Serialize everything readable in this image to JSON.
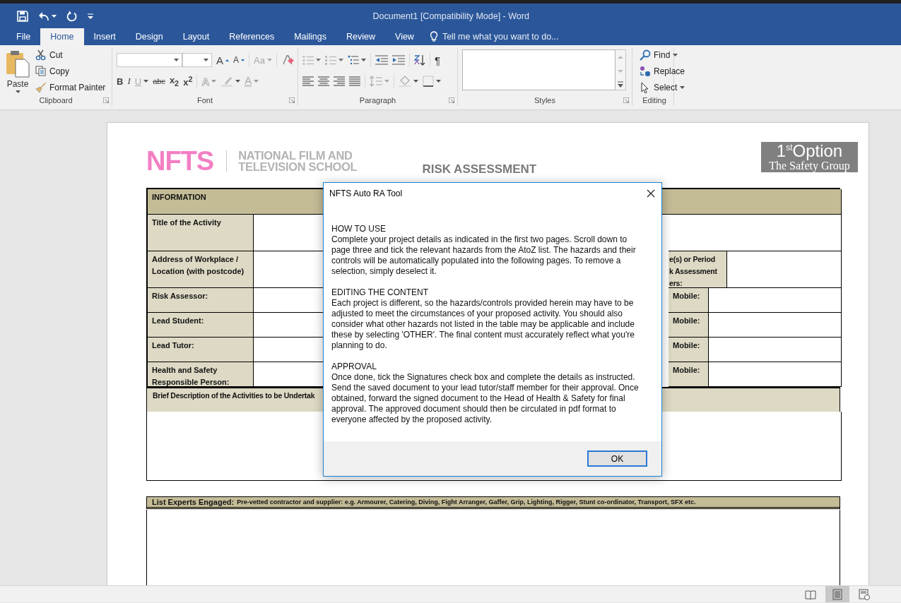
{
  "window": {
    "title": "Document1 [Compatibility Mode] - Word"
  },
  "tabs": [
    {
      "label": "File",
      "selected": false
    },
    {
      "label": "Home",
      "selected": true
    },
    {
      "label": "Insert",
      "selected": false
    },
    {
      "label": "Design",
      "selected": false
    },
    {
      "label": "Layout",
      "selected": false
    },
    {
      "label": "References",
      "selected": false
    },
    {
      "label": "Mailings",
      "selected": false
    },
    {
      "label": "Review",
      "selected": false
    },
    {
      "label": "View",
      "selected": false
    }
  ],
  "tell_me": {
    "placeholder": "Tell me what you want to do..."
  },
  "clipboard": {
    "label": "Clipboard",
    "paste": "Paste",
    "actions": [
      {
        "label": "Cut",
        "kind": "cut"
      },
      {
        "label": "Copy",
        "kind": "copy"
      },
      {
        "label": "Format Painter",
        "kind": "painter"
      }
    ]
  },
  "font": {
    "label": "Font",
    "size_buttons": [
      {
        "label": "A",
        "kind": "grow"
      },
      {
        "label": "A",
        "kind": "shrink"
      }
    ],
    "change_case": {
      "label": "Aa",
      "disabled": true
    },
    "styles": [
      {
        "label": "B",
        "kind": "bold",
        "disabled": false
      },
      {
        "label": "I",
        "kind": "italic",
        "disabled": false
      },
      {
        "label": "U",
        "kind": "underline",
        "disabled": true
      },
      {
        "label": "abc",
        "kind": "strike",
        "disabled": false
      },
      {
        "label": "x$_{2}$",
        "kind": "sub",
        "disabled": false
      },
      {
        "label": "x$^{2}$",
        "kind": "sup",
        "disabled": false
      }
    ],
    "effects": [
      {
        "label": "A",
        "kind": "effects",
        "disabled": true
      },
      {
        "label": "A",
        "kind": "color",
        "disabled": true
      }
    ]
  },
  "paragraph": {
    "label": "Paragraph",
    "show_marks": "¶"
  },
  "styles": {
    "label": "Styles"
  },
  "editing": {
    "label": "Editing",
    "actions": [
      {
        "label": "Find",
        "kind": "find"
      },
      {
        "label": "Replace",
        "kind": "replace"
      },
      {
        "label": "Select",
        "kind": "select"
      }
    ]
  },
  "document": {
    "logo": {
      "mark": "NFTS",
      "name_lines": [
        "NATIONAL FILM AND",
        "TELEVISION SCHOOL"
      ]
    },
    "heading": "RISK ASSESSMENT",
    "partner": {
      "name": "1$^{st}$Option",
      "tagline": "The Safety Group"
    },
    "table": {
      "header": "INFORMATION",
      "rows": [
        {
          "label": "Title of the Activity",
          "kind": "title"
        },
        {
          "label": "Address of Workplace / Location (with postcode)",
          "kind": "address",
          "side_label": "e(s) or Period\nk Assessment\ners:"
        },
        {
          "label": "Risk Assessor:",
          "kind": "contact",
          "side_label": "Mobile:"
        },
        {
          "label": "Lead Student:",
          "kind": "contact",
          "side_label": "Mobile:"
        },
        {
          "label": "Lead Tutor:",
          "kind": "contact",
          "side_label": "Mobile:"
        },
        {
          "label": "Health and Safety Responsible Person:",
          "kind": "contact",
          "side_label": "Mobile:"
        }
      ],
      "description": "Brief Description of the Activities to be Undertak"
    },
    "experts": {
      "label": "List Experts Engaged:",
      "hint": "Pre-vetted contractor and supplier: e.g. Armourer, Catering, Diving, Fight Arranger, Gaffer, Grip, Lighting, Rigger, Stunt co-ordinator, Transport, SFX etc."
    }
  },
  "dialog": {
    "title": "NFTS Auto RA Tool",
    "sections": [
      {
        "heading": "HOW TO USE",
        "text": "Complete your project details as indicated in the first two pages. Scroll down to page three and tick the relevant hazards from the AtoZ list. The hazards and their controls will be automatically populated into the following pages. To remove a selection, simply deselect it."
      },
      {
        "heading": "EDITING THE CONTENT",
        "text": "Each project is different, so the hazards/controls provided herein may have to be adjusted to meet the circumstances of your proposed activity. You should also consider what other hazards not listed in the table may be applicable and include these by selecting 'OTHER'. The final content must accurately reflect what you're planning to do."
      },
      {
        "heading": "APPROVAL",
        "text": "Once done, tick the Signatures check box and complete the details as instructed. Send the saved document to your lead tutor/staff member for their approval. Once obtained, forward the signed document to the Head of Health & Safety for final approval. The approved document should then be circulated in pdf format to everyone affected by the proposed activity."
      }
    ],
    "button": "OK"
  },
  "views": [
    {
      "kind": "read",
      "selected": false
    },
    {
      "kind": "print",
      "selected": true
    },
    {
      "kind": "web",
      "selected": false
    }
  ]
}
